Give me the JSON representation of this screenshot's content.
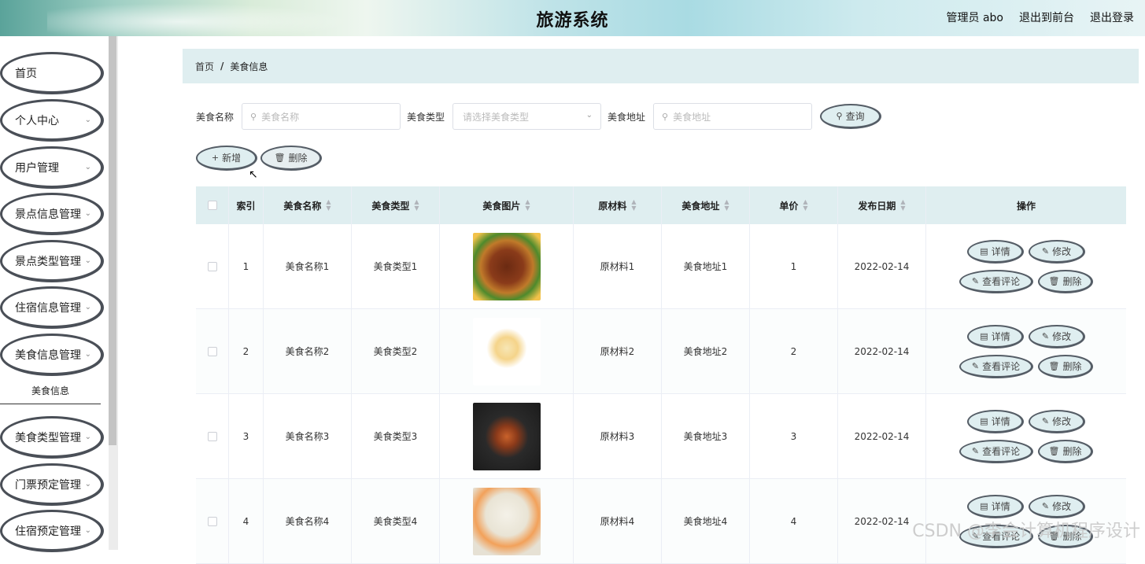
{
  "header": {
    "title": "旅游系统",
    "admin": "管理员 abo",
    "back_front": "退出到前台",
    "logout": "退出登录"
  },
  "sidebar": {
    "items": [
      {
        "label": "首页",
        "has_arrow": false
      },
      {
        "label": "个人中心",
        "has_arrow": true
      },
      {
        "label": "用户管理",
        "has_arrow": true
      },
      {
        "label": "景点信息管理",
        "has_arrow": true
      },
      {
        "label": "景点类型管理",
        "has_arrow": true
      },
      {
        "label": "住宿信息管理",
        "has_arrow": true
      },
      {
        "label": "美食信息管理",
        "has_arrow": true
      },
      {
        "label": "美食类型管理",
        "has_arrow": true
      },
      {
        "label": "门票预定管理",
        "has_arrow": true
      },
      {
        "label": "住宿预定管理",
        "has_arrow": true
      }
    ],
    "subitem": "美食信息"
  },
  "breadcrumb": {
    "home": "首页",
    "sep": "/",
    "current": "美食信息"
  },
  "search": {
    "name_label": "美食名称",
    "name_placeholder": "美食名称",
    "type_label": "美食类型",
    "type_placeholder": "请选择美食类型",
    "addr_label": "美食地址",
    "addr_placeholder": "美食地址",
    "search_btn": "查询"
  },
  "actions": {
    "add": "新增",
    "delete": "删除"
  },
  "table": {
    "headers": [
      "索引",
      "美食名称",
      "美食类型",
      "美食图片",
      "原材料",
      "美食地址",
      "单价",
      "发布日期",
      "操作"
    ],
    "rows": [
      {
        "idx": "1",
        "name": "美食名称1",
        "type": "美食类型1",
        "mat": "原材料1",
        "addr": "美食地址1",
        "price": "1",
        "date": "2022-02-14"
      },
      {
        "idx": "2",
        "name": "美食名称2",
        "type": "美食类型2",
        "mat": "原材料2",
        "addr": "美食地址2",
        "price": "2",
        "date": "2022-02-14"
      },
      {
        "idx": "3",
        "name": "美食名称3",
        "type": "美食类型3",
        "mat": "原材料3",
        "addr": "美食地址3",
        "price": "3",
        "date": "2022-02-14"
      },
      {
        "idx": "4",
        "name": "美食名称4",
        "type": "美食类型4",
        "mat": "原材料4",
        "addr": "美食地址4",
        "price": "4",
        "date": "2022-02-14"
      }
    ],
    "ops": {
      "detail": "详情",
      "edit": "修改",
      "comment": "查看评论",
      "delete": "删除"
    }
  },
  "watermark": "CSDN @李会计算机程序设计"
}
